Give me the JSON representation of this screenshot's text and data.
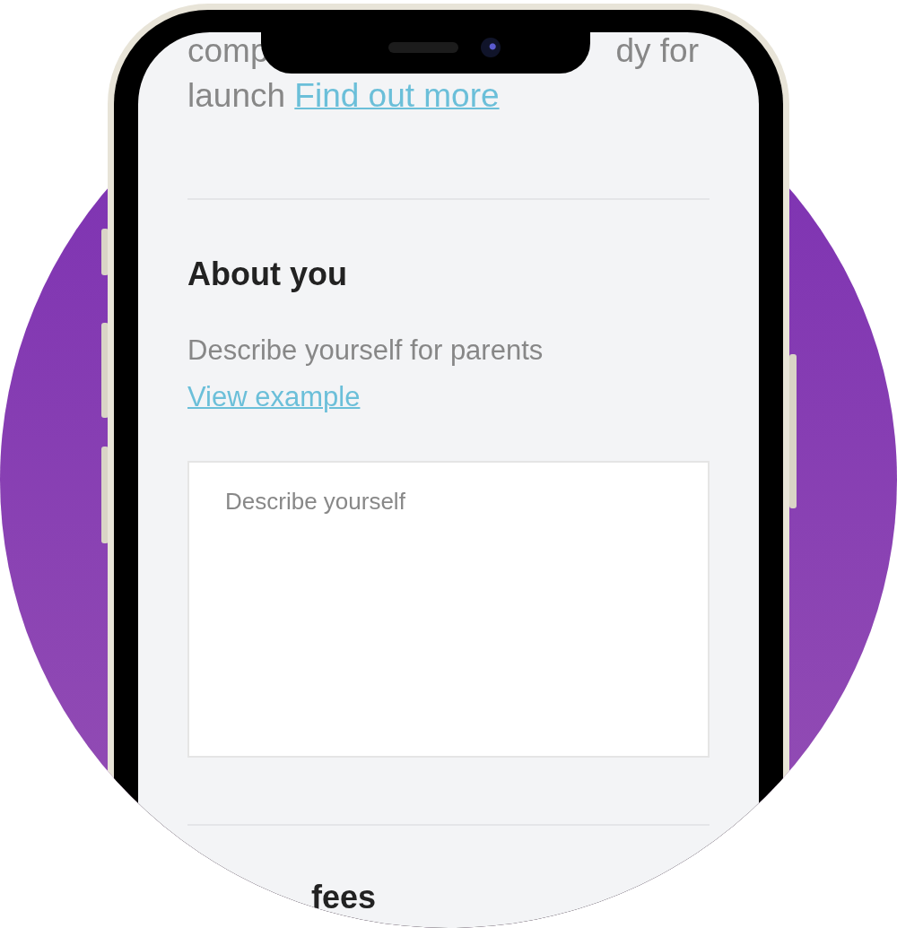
{
  "intro": {
    "fragments": [
      "comp",
      "dy for"
    ],
    "line_start": "launch",
    "link": "Find out more"
  },
  "about": {
    "heading": "About you",
    "description": "Describe yourself for parents",
    "link": "View example",
    "textarea": {
      "placeholder": "Describe yourself"
    }
  },
  "next_heading": "fees"
}
